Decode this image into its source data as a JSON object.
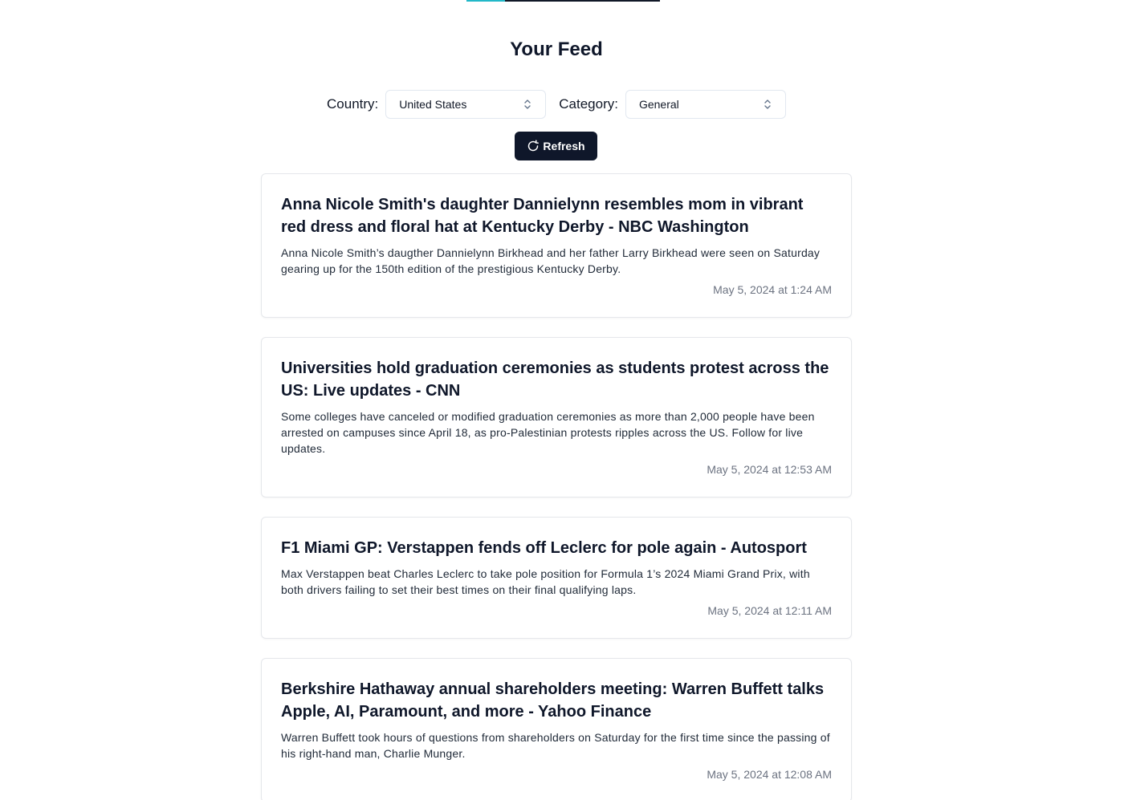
{
  "page": {
    "title": "Your Feed"
  },
  "filters": {
    "country_label": "Country:",
    "country_value": "United States",
    "category_label": "Category:",
    "category_value": "General"
  },
  "actions": {
    "refresh_label": "Refresh"
  },
  "icons": {
    "refresh": "refresh-icon",
    "select": "chevron-up-down-icon"
  },
  "colors": {
    "accent": "#22b8c8",
    "button_bg": "#0f172a"
  },
  "articles": [
    {
      "title": "Anna Nicole Smith's daughter Dannielynn resembles mom in vibrant red dress and floral hat at Kentucky Derby - NBC Washington",
      "description": "Anna Nicole Smith’s daugther Dannielynn Birkhead and her father Larry Birkhead were seen on Saturday gearing up for the 150th edition of the prestigious Kentucky Derby.",
      "date": "May 5, 2024 at 1:24 AM"
    },
    {
      "title": "Universities hold graduation ceremonies as students protest across the US: Live updates - CNN",
      "description": "Some colleges have canceled or modified graduation ceremonies as more than 2,000 people have been arrested on campuses since April 18, as pro-Palestinian protests ripples across the US. Follow for live updates.",
      "date": "May 5, 2024 at 12:53 AM"
    },
    {
      "title": "F1 Miami GP: Verstappen fends off Leclerc for pole again - Autosport",
      "description": "Max Verstappen beat Charles Leclerc to take pole position for Formula 1’s 2024 Miami Grand Prix, with both drivers failing to set their best times on their final qualifying laps.",
      "date": "May 5, 2024 at 12:11 AM"
    },
    {
      "title": "Berkshire Hathaway annual shareholders meeting: Warren Buffett talks Apple, AI, Paramount, and more - Yahoo Finance",
      "description": "Warren Buffett took hours of questions from shareholders on Saturday for the first time since the passing of his right-hand man, Charlie Munger.",
      "date": "May 5, 2024 at 12:08 AM"
    }
  ]
}
